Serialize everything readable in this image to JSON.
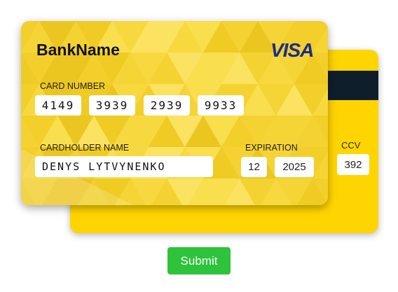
{
  "card_front": {
    "bank_name": "BankName",
    "brand": "VISA",
    "card_number_label": "CARD NUMBER",
    "card_number_groups": [
      "4149",
      "3939",
      "2939",
      "9933"
    ],
    "cardholder_label": "CARDHOLDER NAME",
    "cardholder_name": "DENYS LYTVYNENKO",
    "expiration_label": "EXPIRATION",
    "expiration_month": "12",
    "expiration_year": "2025"
  },
  "card_back": {
    "ccv_label": "CCV",
    "ccv_value": "392"
  },
  "submit_label": "Submit",
  "colors": {
    "card_yellow": "#ffd500",
    "stripe": "#0e1f2b",
    "visa_blue": "#1a2b8f",
    "submit_green": "#2fc33b"
  }
}
